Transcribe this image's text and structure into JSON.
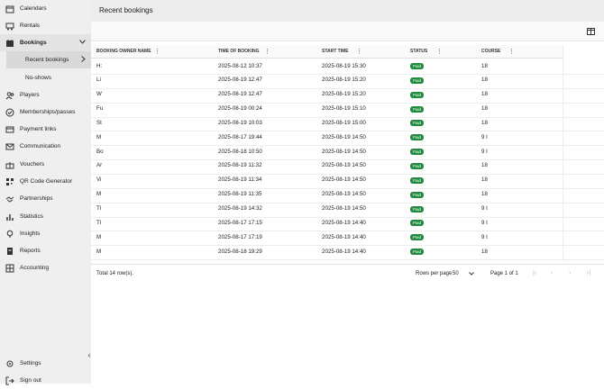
{
  "sidebar": {
    "items": [
      {
        "label": "Calendars",
        "icon": "calendar-icon"
      },
      {
        "label": "Rentals",
        "icon": "cart-icon"
      },
      {
        "label": "Bookings",
        "icon": "bookings-icon"
      },
      {
        "label": "Recent bookings"
      },
      {
        "label": "No-shows"
      },
      {
        "label": "Players",
        "icon": "players-icon"
      },
      {
        "label": "Memberships/passes",
        "icon": "membership-icon"
      },
      {
        "label": "Payment links",
        "icon": "payment-link-icon"
      },
      {
        "label": "Communication",
        "icon": "mail-icon"
      },
      {
        "label": "Vouchers",
        "icon": "gift-icon"
      },
      {
        "label": "QR Code Generator",
        "icon": "qr-icon"
      },
      {
        "label": "Partnerships",
        "icon": "handshake-icon"
      },
      {
        "label": "Statistics",
        "icon": "bar-chart-icon"
      },
      {
        "label": "Insights",
        "icon": "lightbulb-icon"
      },
      {
        "label": "Reports",
        "icon": "report-icon"
      },
      {
        "label": "Accounting",
        "icon": "accounting-icon"
      }
    ],
    "settings": "Settings",
    "signout": "Sign out"
  },
  "header": {
    "title": "Recent bookings"
  },
  "table": {
    "columns": [
      "BOOKING OWNER NAME",
      "TIME OF BOOKING",
      "START TIME",
      "STATUS",
      "COURSE"
    ],
    "rows": [
      {
        "name": "H:",
        "booked": "2025-08-12 10:37",
        "start": "2025-08-19 15:30",
        "status": "Paid",
        "course": "18"
      },
      {
        "name": "Li",
        "booked": "2025-08-19 12:47",
        "start": "2025-08-19 15:20",
        "status": "Paid",
        "course": "18"
      },
      {
        "name": "W",
        "booked": "2025-08-19 12:47",
        "start": "2025-08-19 15:20",
        "status": "Paid",
        "course": "18"
      },
      {
        "name": "Fu",
        "booked": "2025-08-19 00:24",
        "start": "2025-08-19 15:10",
        "status": "Paid",
        "course": "18"
      },
      {
        "name": "St",
        "booked": "2025-08-19 10:03",
        "start": "2025-08-19 15:00",
        "status": "Paid",
        "course": "18"
      },
      {
        "name": "M",
        "booked": "2025-08-17 19:44",
        "start": "2025-08-19 14:50",
        "status": "Paid",
        "course": "9 I"
      },
      {
        "name": "Bo",
        "booked": "2025-08-18 10:50",
        "start": "2025-08-19 14:50",
        "status": "Paid",
        "course": "9 I"
      },
      {
        "name": "Ar",
        "booked": "2025-08-19 11:32",
        "start": "2025-08-19 14:50",
        "status": "Paid",
        "course": "18"
      },
      {
        "name": "Vi",
        "booked": "2025-08-19 11:34",
        "start": "2025-08-19 14:50",
        "status": "Paid",
        "course": "18"
      },
      {
        "name": "M",
        "booked": "2025-08-19 11:35",
        "start": "2025-08-19 14:50",
        "status": "Paid",
        "course": "18"
      },
      {
        "name": "Tl",
        "booked": "2025-08-19 14:32",
        "start": "2025-08-19 14:50",
        "status": "Paid",
        "course": "9 I"
      },
      {
        "name": "Tl",
        "booked": "2025-08-17 17:15",
        "start": "2025-08-19 14:40",
        "status": "Paid",
        "course": "9 I"
      },
      {
        "name": "M",
        "booked": "2025-08-17 17:19",
        "start": "2025-08-19 14:40",
        "status": "Paid",
        "course": "9 I"
      },
      {
        "name": "M",
        "booked": "2025-08-18 19:29",
        "start": "2025-08-19 14:40",
        "status": "Paid",
        "course": "18"
      }
    ]
  },
  "footer": {
    "total": "Total 14 row(s).",
    "rows_per_page_label": "Rows per page",
    "rows_per_page_value": "50",
    "page_info": "Page 1 of 1"
  },
  "colors": {
    "paid": "#1f8a3b",
    "sidebar": "#efefef"
  }
}
